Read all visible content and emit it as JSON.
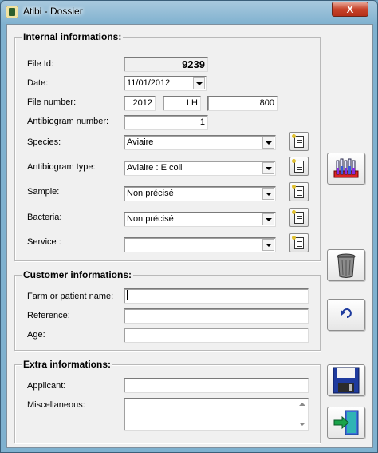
{
  "window": {
    "title": "Atibi - Dossier",
    "close_label": "X"
  },
  "internal": {
    "legend": "Internal informations:",
    "file_id": {
      "label": "File Id:",
      "value": "9239"
    },
    "date": {
      "label": "Date:",
      "value": "11/01/2012"
    },
    "file_number": {
      "label": "File number:",
      "year": "2012",
      "code": "LH",
      "number": "800"
    },
    "antibiogram_number": {
      "label": "Antibiogram number:",
      "value": "1"
    },
    "species": {
      "label": "Species:",
      "value": "Aviaire"
    },
    "antibiogram_type": {
      "label": "Antibiogram type:",
      "value": "Aviaire : E coli"
    },
    "sample": {
      "label": "Sample:",
      "value": "Non précisé"
    },
    "bacteria": {
      "label": "Bacteria:",
      "value": "Non précisé"
    },
    "service": {
      "label": "Service :",
      "value": ""
    }
  },
  "customer": {
    "legend": "Customer informations:",
    "farm": {
      "label": "Farm or patient name:",
      "value": ""
    },
    "reference": {
      "label": "Reference:",
      "value": ""
    },
    "age": {
      "label": "Age:",
      "value": ""
    }
  },
  "extra": {
    "legend": "Extra informations:",
    "applicant": {
      "label": "Applicant:",
      "value": ""
    },
    "misc": {
      "label": "Miscellaneous:",
      "value": ""
    }
  },
  "icons": {
    "edit_list": "edit-list-icon",
    "antibiogram": "test-tubes-icon",
    "delete": "trash-icon",
    "undo": "undo-icon",
    "save": "floppy-disk-icon",
    "exit": "exit-door-icon"
  },
  "colors": {
    "title_bar": "#7fb1cf",
    "close_button": "#c7432a",
    "save_blue": "#1f3b9e"
  }
}
